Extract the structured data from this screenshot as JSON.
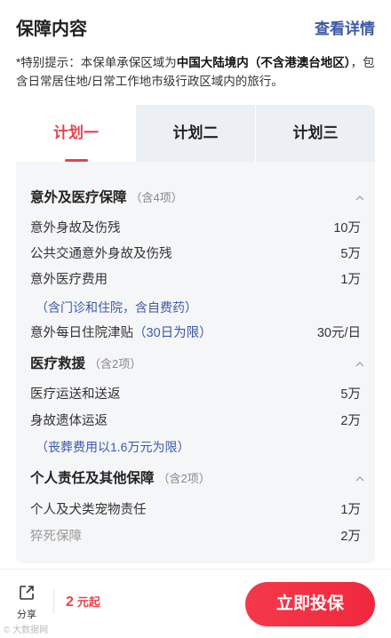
{
  "header": {
    "title": "保障内容",
    "detail_link": "查看详情"
  },
  "notice": {
    "prefix": "*特别提示：本保单承保区域为",
    "bold": "中国大陆境内（不含港澳台地区）",
    "suffix": "，包含日常居住地/日常工作地市级行政区域内的旅行。"
  },
  "tabs": [
    {
      "label": "计划一",
      "active": true
    },
    {
      "label": "计划二",
      "active": false
    },
    {
      "label": "计划三",
      "active": false
    }
  ],
  "sections": [
    {
      "title": "意外及医疗保障",
      "count": "（含4项）",
      "rows": [
        {
          "name": "意外身故及伤残",
          "value": "10万"
        },
        {
          "name": "公共交通意外身故及伤残",
          "value": "5万"
        },
        {
          "name": "意外医疗费用",
          "value": "1万"
        },
        {
          "note": "（含门诊和住院，含自费药）"
        },
        {
          "name": "意外每日住院津贴",
          "inline_note": "（30日为限）",
          "value": "30元/日"
        }
      ]
    },
    {
      "title": "医疗救援",
      "count": "（含2项）",
      "rows": [
        {
          "name": "医疗运送和送返",
          "value": "5万"
        },
        {
          "name": "身故遗体运返",
          "value": "2万"
        },
        {
          "note": "（丧葬费用以1.6万元为限）"
        }
      ]
    },
    {
      "title": "个人责任及其他保障",
      "count": "（含2项）",
      "rows": [
        {
          "name": "个人及犬类宠物责任",
          "value": "1万"
        },
        {
          "name": "猝死保障",
          "value": "2万"
        }
      ]
    }
  ],
  "bottom": {
    "share_label": "分享",
    "price": "2",
    "price_unit": "元起",
    "buy_label": "立即投保"
  },
  "watermark": "© 大数据网",
  "colors": {
    "accent": "#e8434d",
    "link": "#3d5aa8"
  }
}
